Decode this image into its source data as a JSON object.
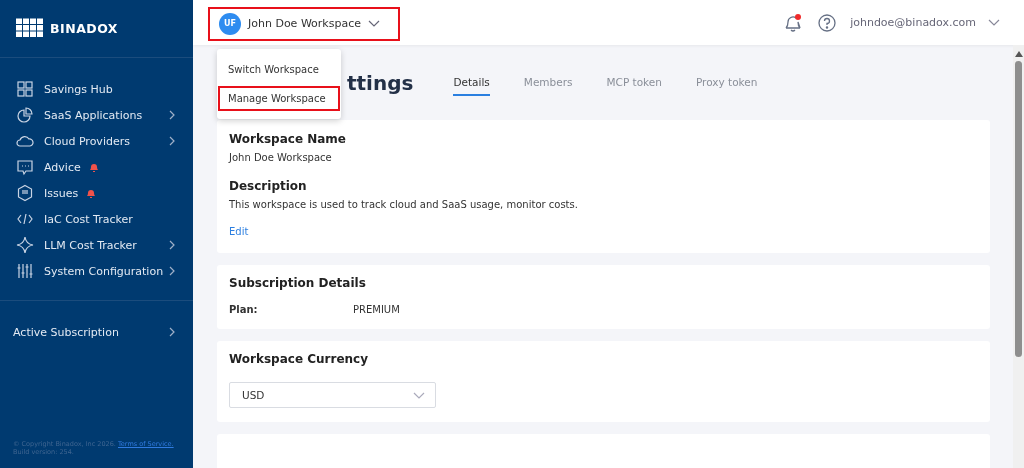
{
  "sidebar": {
    "logo": "BINADOX",
    "items": [
      {
        "label": "Savings Hub",
        "kind": "grid",
        "alert": false,
        "has_submenu": false
      },
      {
        "label": "SaaS Applications",
        "kind": "pie",
        "alert": false,
        "has_submenu": true
      },
      {
        "label": "Cloud Providers",
        "kind": "cloud",
        "alert": false,
        "has_submenu": true
      },
      {
        "label": "Advice",
        "kind": "chat",
        "alert": true,
        "has_submenu": false
      },
      {
        "label": "Issues",
        "kind": "hex",
        "alert": true,
        "has_submenu": false
      },
      {
        "label": "IaC Cost Tracker",
        "kind": "code",
        "alert": false,
        "has_submenu": false
      },
      {
        "label": "LLM Cost Tracker",
        "kind": "star",
        "alert": false,
        "has_submenu": true
      },
      {
        "label": "System Configuration",
        "kind": "sliders",
        "alert": false,
        "has_submenu": true
      }
    ],
    "subscription": {
      "label": "Active Subscription"
    },
    "footer": {
      "copyright": "© Copyright Binadox, Inc 2026.",
      "terms_link": "Terms of Service.",
      "build": "Build version: 254."
    }
  },
  "header": {
    "workspace": {
      "initials": "UF",
      "name": "John Doe Workspace",
      "highlighted": true
    },
    "notifications": {
      "unread": true
    },
    "user_email": "johndoe@binadox.com"
  },
  "workspace_menu": [
    {
      "label": "Switch Workspace",
      "highlighted": false
    },
    {
      "label": "Manage Workspace",
      "highlighted": true
    }
  ],
  "page": {
    "title_visible": "ttings",
    "tabs": [
      {
        "label": "Details",
        "selected": true
      },
      {
        "label": "Members",
        "selected": false
      },
      {
        "label": "MCP token",
        "selected": false
      },
      {
        "label": "Proxy token",
        "selected": false
      }
    ],
    "details": {
      "name_heading": "Workspace Name",
      "name": "John Doe Workspace",
      "description_heading": "Description",
      "description": "This workspace is used to track cloud and SaaS usage, monitor costs.",
      "edit_link": "Edit"
    },
    "subscription": {
      "heading": "Subscription Details",
      "plan_label": "Plan:",
      "plan": "PREMIUM"
    },
    "currency": {
      "heading": "Workspace Currency",
      "value": "USD"
    }
  }
}
